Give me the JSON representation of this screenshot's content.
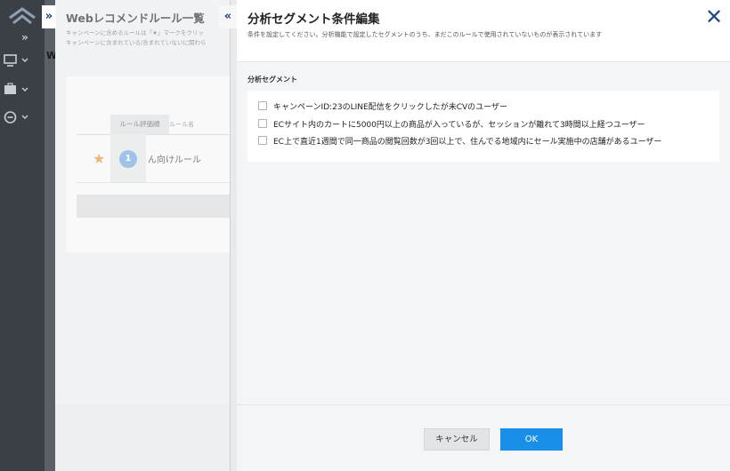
{
  "app_sidebar": {
    "nav": [
      {
        "icon": "monitor-icon"
      },
      {
        "icon": "briefcase-icon"
      },
      {
        "icon": "minus-circle-icon"
      }
    ]
  },
  "background_strip": {
    "letter": "W"
  },
  "rule_panel": {
    "title": "Webレコメンドルール一覧",
    "description_line1": "キャンペーンに含めるルールは「★」マークをクリッ",
    "description_line2": "キャンペーンに含まれている/含まれていないに関わら",
    "column_eval": "ルール評価順",
    "column_name": "ルール名",
    "rows": [
      {
        "rank": "1",
        "name": "ん向けルール"
      }
    ]
  },
  "modal": {
    "title": "分析セグメント条件編集",
    "subtitle": "条件を設定してください。分析機能で設定したセグメントのうち、まだこのルールで使用されていないものが表示されています",
    "section_label": "分析セグメント",
    "segments": [
      {
        "label": "キャンペーンID:23のLINE配信をクリックしたが未CVのユーザー",
        "checked": false
      },
      {
        "label": "ECサイト内のカートに5000円以上の商品が入っているが、セッションが離れて3時間以上経つユーザー",
        "checked": false
      },
      {
        "label": "EC上で直近1週間で同一商品の閲覧回数が3回以上で、住んでる地域内にセール実施中の店舗があるユーザー",
        "checked": false
      }
    ],
    "cancel_label": "キャンセル",
    "ok_label": "OK"
  },
  "colors": {
    "accent": "#1a8fe8",
    "close_icon": "#1f4f8a",
    "sidebar": "#3b4047"
  }
}
